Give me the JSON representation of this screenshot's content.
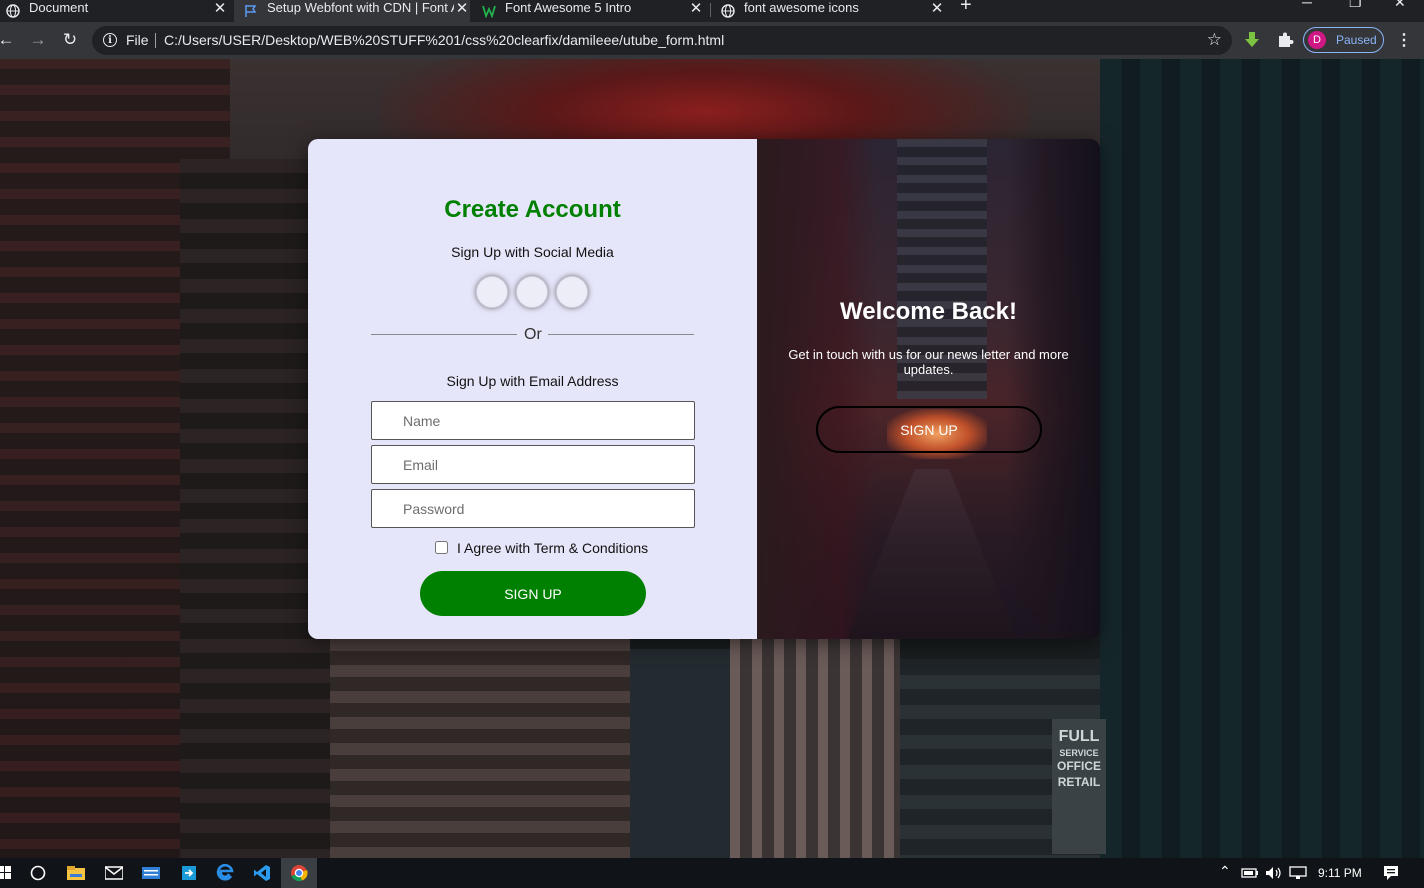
{
  "browser": {
    "tabs": [
      {
        "title": "Document",
        "active": false
      },
      {
        "title": "Setup Webfont with CDN | Font Awesome",
        "active": true
      },
      {
        "title": "Font Awesome 5 Intro",
        "active": false
      },
      {
        "title": "font awesome icons",
        "active": false
      }
    ],
    "scheme_label": "File",
    "url": "C:/Users/USER/Desktop/WEB%20STUFF%201/css%20clearfix/damileee/utube_form.html",
    "profile_initial": "D",
    "profile_status": "Paused"
  },
  "form": {
    "title": "Create Account",
    "social_label": "Sign Up with Social Media",
    "divider_label": "Or",
    "email_label": "Sign Up with Email Address",
    "name_placeholder": "Name",
    "email_placeholder": "Email",
    "password_placeholder": "Password",
    "agree_label": "I Agree with Term & Conditions",
    "submit_label": "SIGN UP"
  },
  "side_panel": {
    "title": "Welcome Back!",
    "text": "Get in touch with us for our news letter and more updates.",
    "button_label": "SIGN UP"
  },
  "background_sign": [
    "FULL",
    "SERVICE",
    "OFFICE",
    "RETAIL"
  ],
  "taskbar": {
    "time": "9:11 PM"
  },
  "colors": {
    "accent_green": "#008000",
    "panel_lavender": "#e6e6fa",
    "chrome_dark": "#202124",
    "profile_blue": "#8ab4f8"
  }
}
